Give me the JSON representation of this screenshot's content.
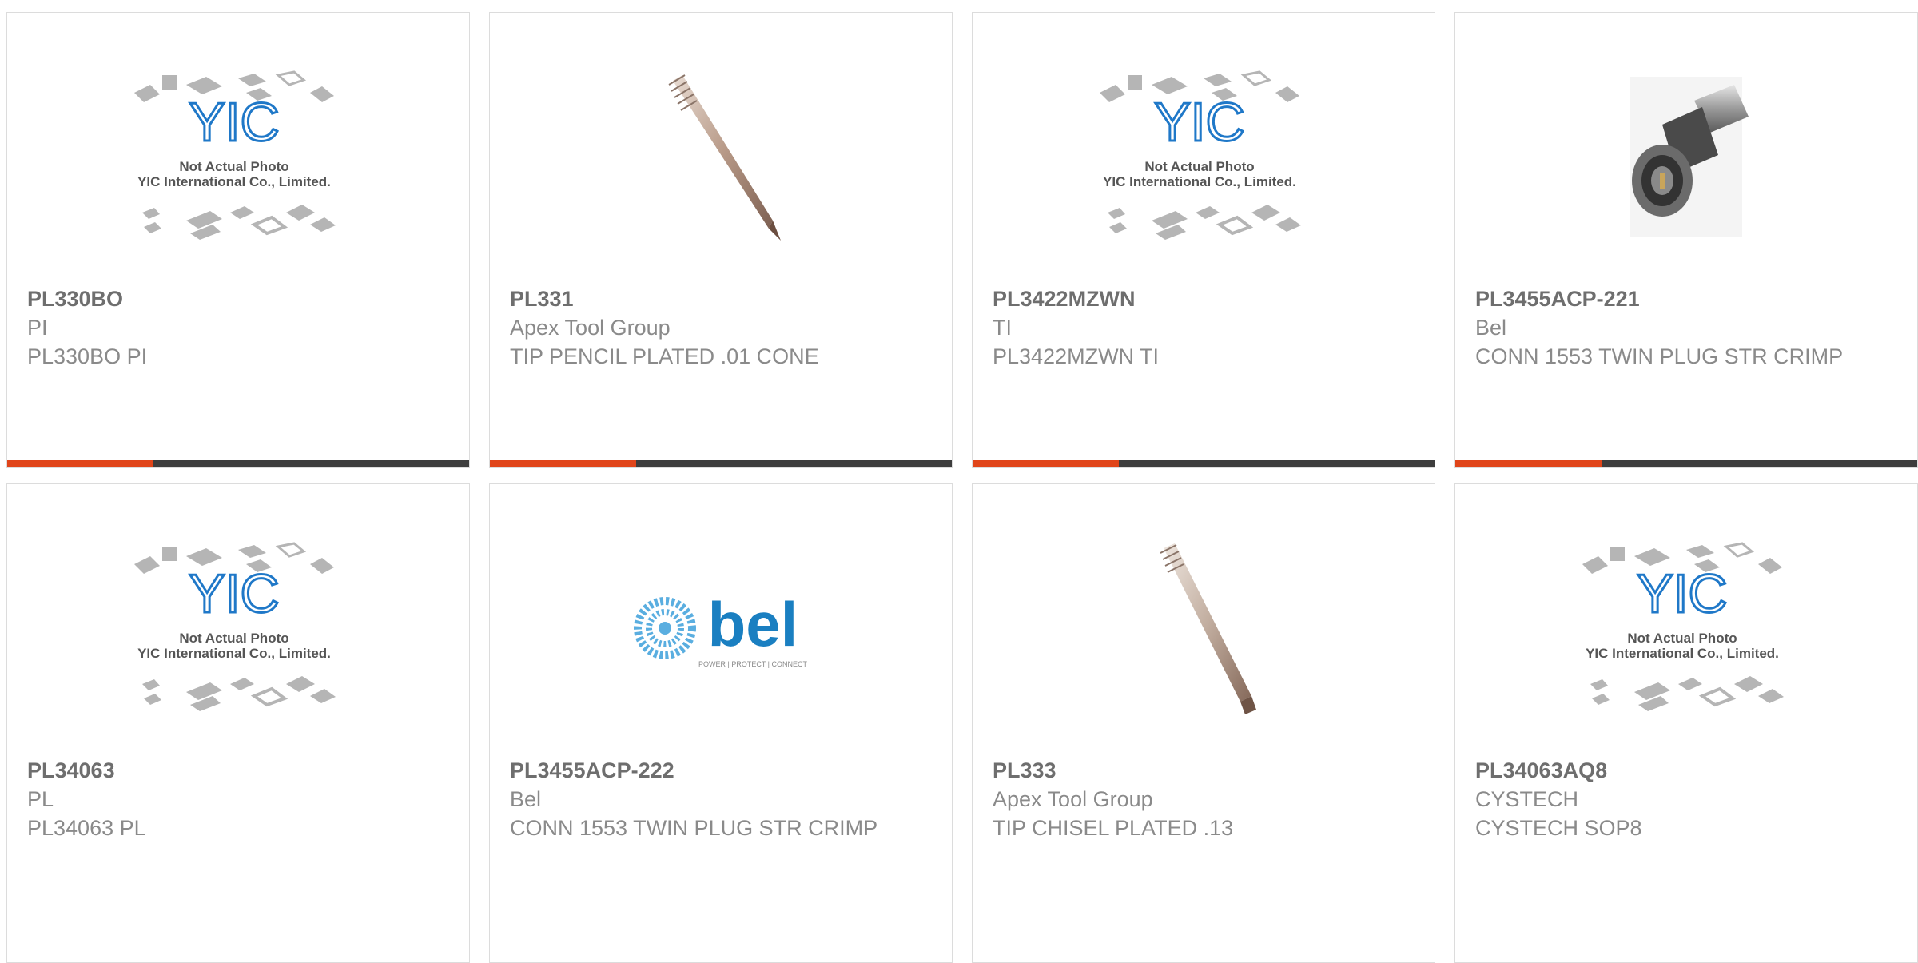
{
  "products": [
    {
      "part": "PL330BO",
      "brand": "PI",
      "desc": "PL330BO PI",
      "image": "placeholder"
    },
    {
      "part": "PL331",
      "brand": "Apex Tool Group",
      "desc": "TIP PENCIL PLATED .01 CONE",
      "image": "cone-tip"
    },
    {
      "part": "PL3422MZWN",
      "brand": "TI",
      "desc": "PL3422MZWN TI",
      "image": "placeholder"
    },
    {
      "part": "PL3455ACP-221",
      "brand": "Bel",
      "desc": "CONN 1553 TWIN PLUG STR CRIMP",
      "image": "connector"
    },
    {
      "part": "PL34063",
      "brand": "PL",
      "desc": "PL34063 PL",
      "image": "placeholder"
    },
    {
      "part": "PL3455ACP-222",
      "brand": "Bel",
      "desc": "CONN 1553 TWIN PLUG STR CRIMP",
      "image": "bel-logo"
    },
    {
      "part": "PL333",
      "brand": "Apex Tool Group",
      "desc": "TIP CHISEL PLATED .13",
      "image": "chisel-tip"
    },
    {
      "part": "PL34063AQ8",
      "brand": "CYSTECH",
      "desc": "CYSTECH SOP8",
      "image": "placeholder"
    }
  ],
  "placeholder": {
    "logo": "YIC",
    "line1": "Not Actual Photo",
    "line2": "YIC International Co., Limited."
  },
  "bel_logo": {
    "word": "bel",
    "tagline": "POWER | PROTECT | CONNECT"
  },
  "colors": {
    "accent": "#e0451a",
    "bar": "#3d3d3d",
    "yic_blue": "#1f78c8",
    "bel_blue": "#1a7fc1"
  }
}
